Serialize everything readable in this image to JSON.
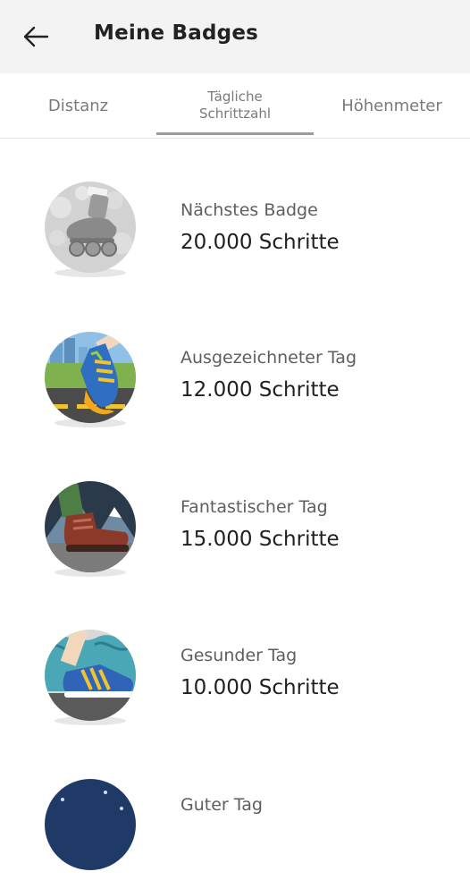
{
  "header": {
    "title": "Meine Badges",
    "back_icon": "arrow-left-icon"
  },
  "tabs": [
    {
      "label": "Distanz",
      "selected": false
    },
    {
      "label": "Tägliche\nSchrittzahl",
      "selected": true
    },
    {
      "label": "Höhenmeter",
      "selected": false
    }
  ],
  "badges": [
    {
      "label": "Nächstes Badge",
      "steps": "20.000 Schritte",
      "icon": "roller-skate-badge-icon",
      "locked": true
    },
    {
      "label": "Ausgezeichneter Tag",
      "steps": "12.000 Schritte",
      "icon": "running-shoe-badge-icon",
      "locked": false
    },
    {
      "label": "Fantastischer Tag",
      "steps": "15.000 Schritte",
      "icon": "hiking-boot-badge-icon",
      "locked": false
    },
    {
      "label": "Gesunder Tag",
      "steps": "10.000 Schritte",
      "icon": "sneaker-badge-icon",
      "locked": false
    },
    {
      "label": "Guter Tag",
      "steps": "",
      "icon": "night-badge-icon",
      "locked": false
    }
  ],
  "colors": {
    "appbar_bg": "#f3f3f3",
    "tab_indicator": "#9c9c9c",
    "title_text": "#222222",
    "label_text": "#5e5e5e"
  }
}
